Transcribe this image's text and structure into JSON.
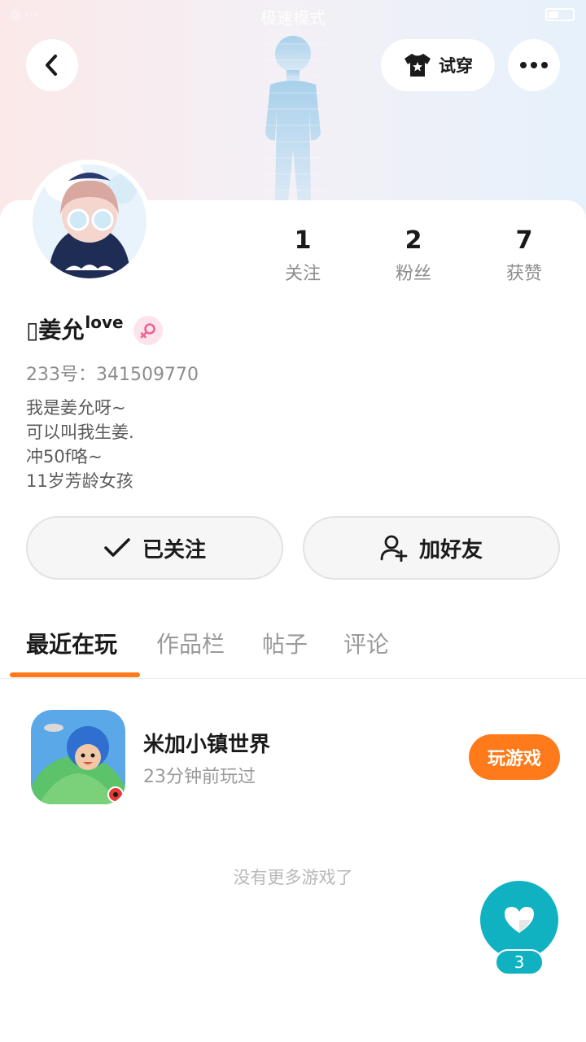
{
  "status_bar": {
    "left": "◎ ···",
    "center": "极速模式"
  },
  "header": {
    "tryon_label": "试穿"
  },
  "colors": {
    "accent": "#ff7a1a",
    "like_fab": "#10b2c2",
    "gender_badge": "#fde4ec"
  },
  "icons": [
    "back-icon",
    "tshirt-icon",
    "more-icon",
    "female-icon",
    "check-icon",
    "add-friend-icon",
    "heart-icon"
  ],
  "profile": {
    "name": "▯姜允",
    "name_sup": "love",
    "uid": "233号：341509770",
    "bio": [
      "我是姜允呀~",
      "可以叫我生姜.",
      "冲50f咯~",
      "11岁芳龄女孩"
    ]
  },
  "stats": [
    {
      "value": "1",
      "label": "关注"
    },
    {
      "value": "2",
      "label": "粉丝"
    },
    {
      "value": "7",
      "label": "获赞"
    }
  ],
  "actions": {
    "follow_label": "已关注",
    "friend_label": "加好友"
  },
  "tabs": [
    "最近在玩",
    "作品栏",
    "帖子",
    "评论"
  ],
  "active_tab": "最近在玩",
  "games": [
    {
      "title": "米加小镇世界",
      "time": "23分钟前玩过",
      "button": "玩游戏"
    }
  ],
  "no_more": "没有更多游戏了",
  "like": {
    "count": "3"
  }
}
